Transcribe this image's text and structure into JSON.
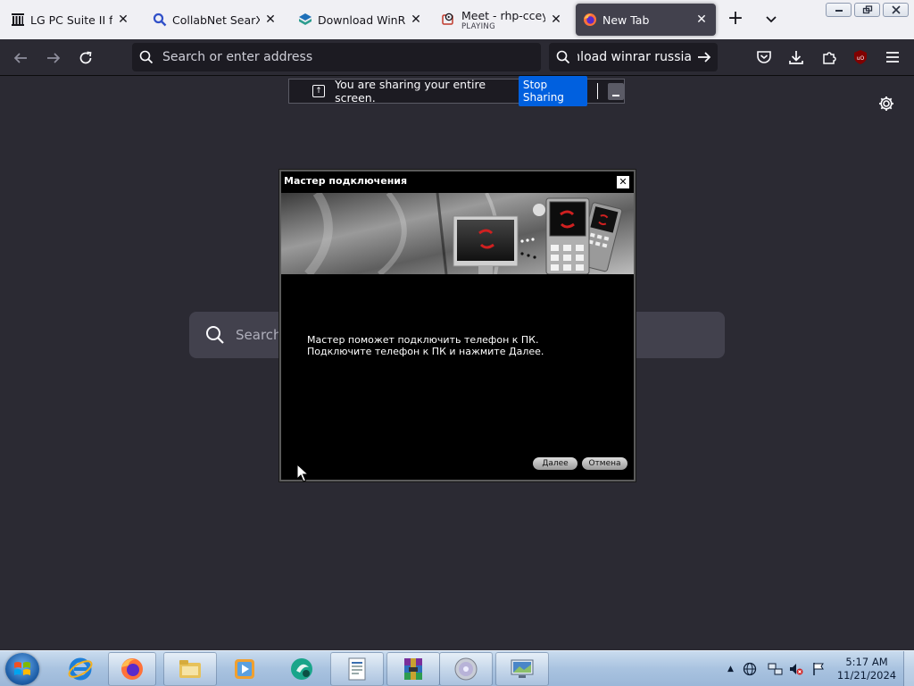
{
  "browser": {
    "tabs": [
      {
        "title": "LG PC Suite II for LG",
        "icon": "library-icon"
      },
      {
        "title": "CollabNet SearXNG",
        "icon": "search-icon"
      },
      {
        "title": "Download WinRAR",
        "icon": "winrar-icon"
      },
      {
        "title": "Meet - rhp-ccey-mj",
        "subtitle": "PLAYING",
        "icon": "meet-icon"
      },
      {
        "title": "New Tab",
        "icon": "firefox-icon",
        "active": true
      }
    ],
    "address_placeholder": "Search or enter address",
    "search_value": "download winrar russia"
  },
  "sharing": {
    "message": "You are sharing your entire screen.",
    "stop_label": "Stop Sharing"
  },
  "newtab": {
    "search_placeholder": "Search"
  },
  "wizard": {
    "title": "Мастер подключения",
    "line1": "Мастер поможет подключить телефон к ПК.",
    "line2": "Подключите телефон к ПК и нажмите Далее.",
    "next_label": "Далее",
    "cancel_label": "Отмена"
  },
  "taskbar": {
    "time": "5:17 AM",
    "date": "11/21/2024"
  },
  "colors": {
    "browser_bg": "#2b2a33",
    "accent": "#0060df",
    "tabstrip": "#f0f0f4"
  }
}
